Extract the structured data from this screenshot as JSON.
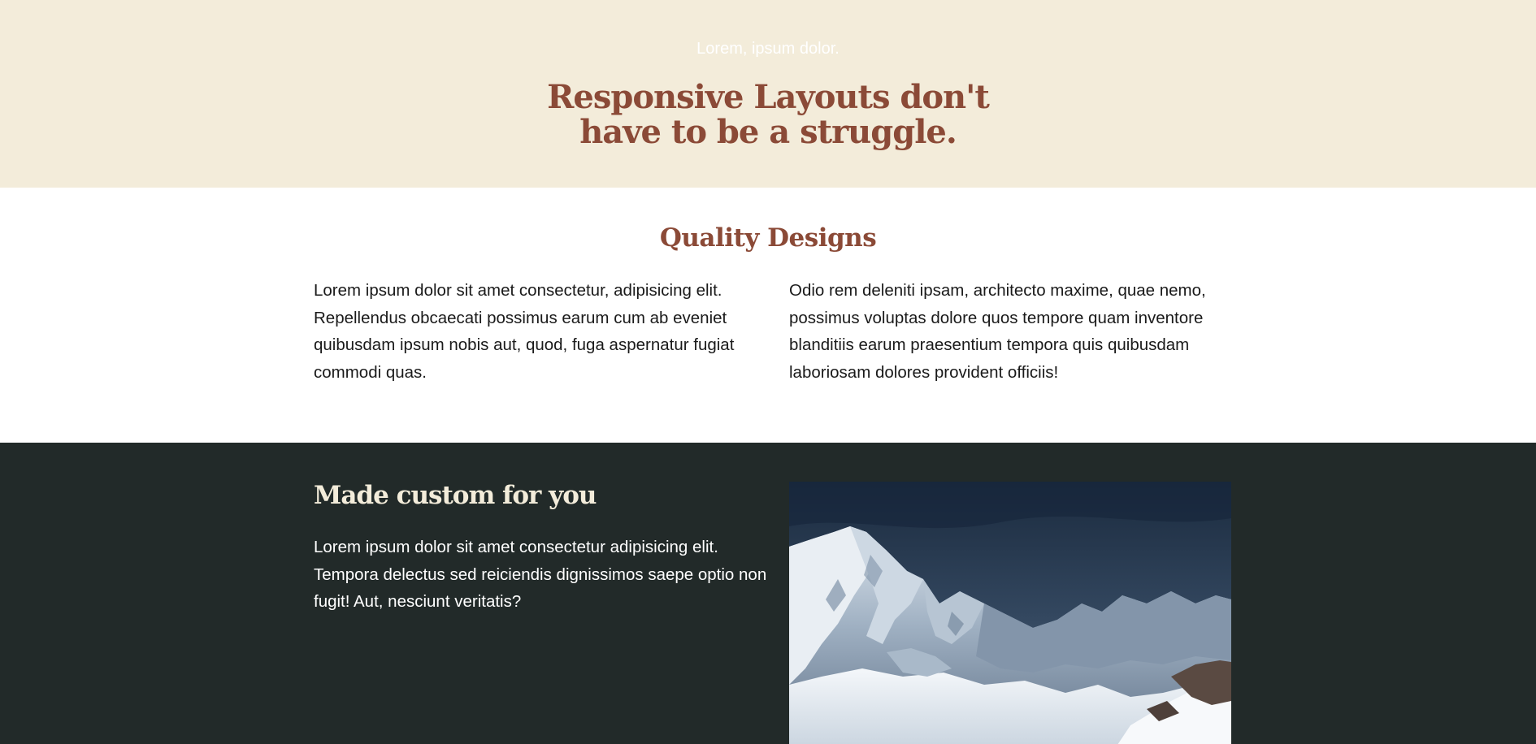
{
  "hero": {
    "kicker": "Lorem, ipsum dolor.",
    "title_line1": "Responsive Layouts don't",
    "title_line2": "have to be a struggle."
  },
  "quality": {
    "title": "Quality Designs",
    "left_text": "Lorem ipsum dolor sit amet consectetur, adipisicing elit. Repellendus obcaecati possimus earum cum ab eveniet quibusdam ipsum nobis aut, quod, fuga aspernatur fugiat commodi quas.",
    "right_text": "Odio rem deleniti ipsam, architecto maxime, quae nemo, possimus voluptas dolore quos tempore quam inventore blanditiis earum praesentium tempora quis quibusdam laboriosam dolores provident officiis!"
  },
  "custom": {
    "title": "Made custom for you",
    "text": "Lorem ipsum dolor sit amet consectetur adipisicing elit. Tempora delectus sed reiciendis dignissimos saepe optio non fugit! Aut, nesciunt veritatis?",
    "image_icon": "mountain-photo"
  },
  "colors": {
    "hero_bg": "#f3ecda",
    "accent_brown": "#8b4a37",
    "dark_bg": "#222a29",
    "cream_text": "#f3ecda"
  }
}
